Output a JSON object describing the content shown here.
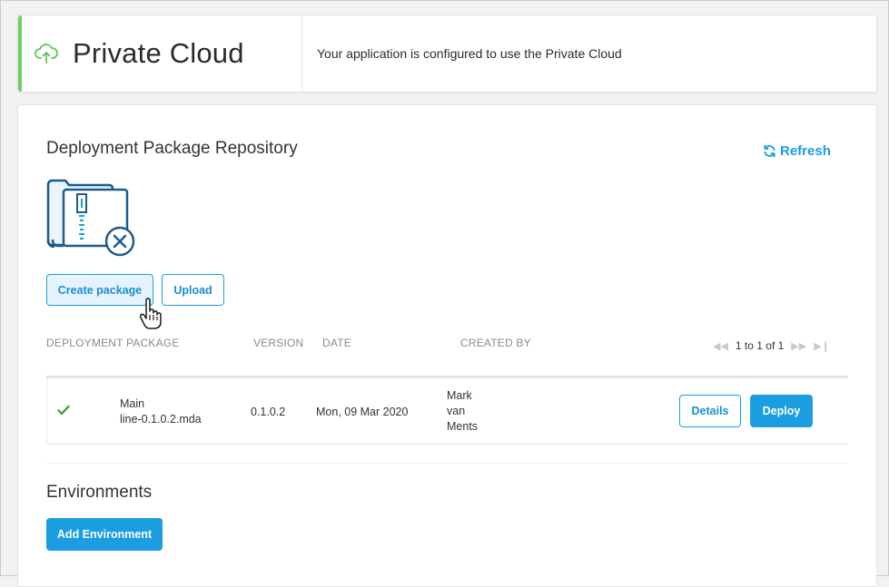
{
  "header": {
    "title": "Private Cloud",
    "message": "Your application is configured to use the Private Cloud",
    "accent_color": "#6cd066",
    "icon": "cloud-upload-icon"
  },
  "repository": {
    "title": "Deployment Package Repository",
    "refresh_label": "Refresh",
    "create_label": "Create package",
    "upload_label": "Upload",
    "columns": [
      "DEPLOYMENT PACKAGE",
      "VERSION",
      "DATE",
      "CREATED BY"
    ],
    "pager_text": "1 to 1 of 1",
    "rows": [
      {
        "status_icon": "check-icon",
        "package_line1": "Main",
        "package_line2": "line-0.1.0.2.mda",
        "version": "0.1.0.2",
        "date": "Mon, 09 Mar 2020",
        "created_by_1": "Mark",
        "created_by_2": "van",
        "created_by_3": "Ments",
        "details_label": "Details",
        "deploy_label": "Deploy"
      }
    ]
  },
  "environments": {
    "title": "Environments",
    "add_label": "Add Environment"
  },
  "colors": {
    "primary": "#1a9ee0",
    "success": "#3aaa4a"
  }
}
